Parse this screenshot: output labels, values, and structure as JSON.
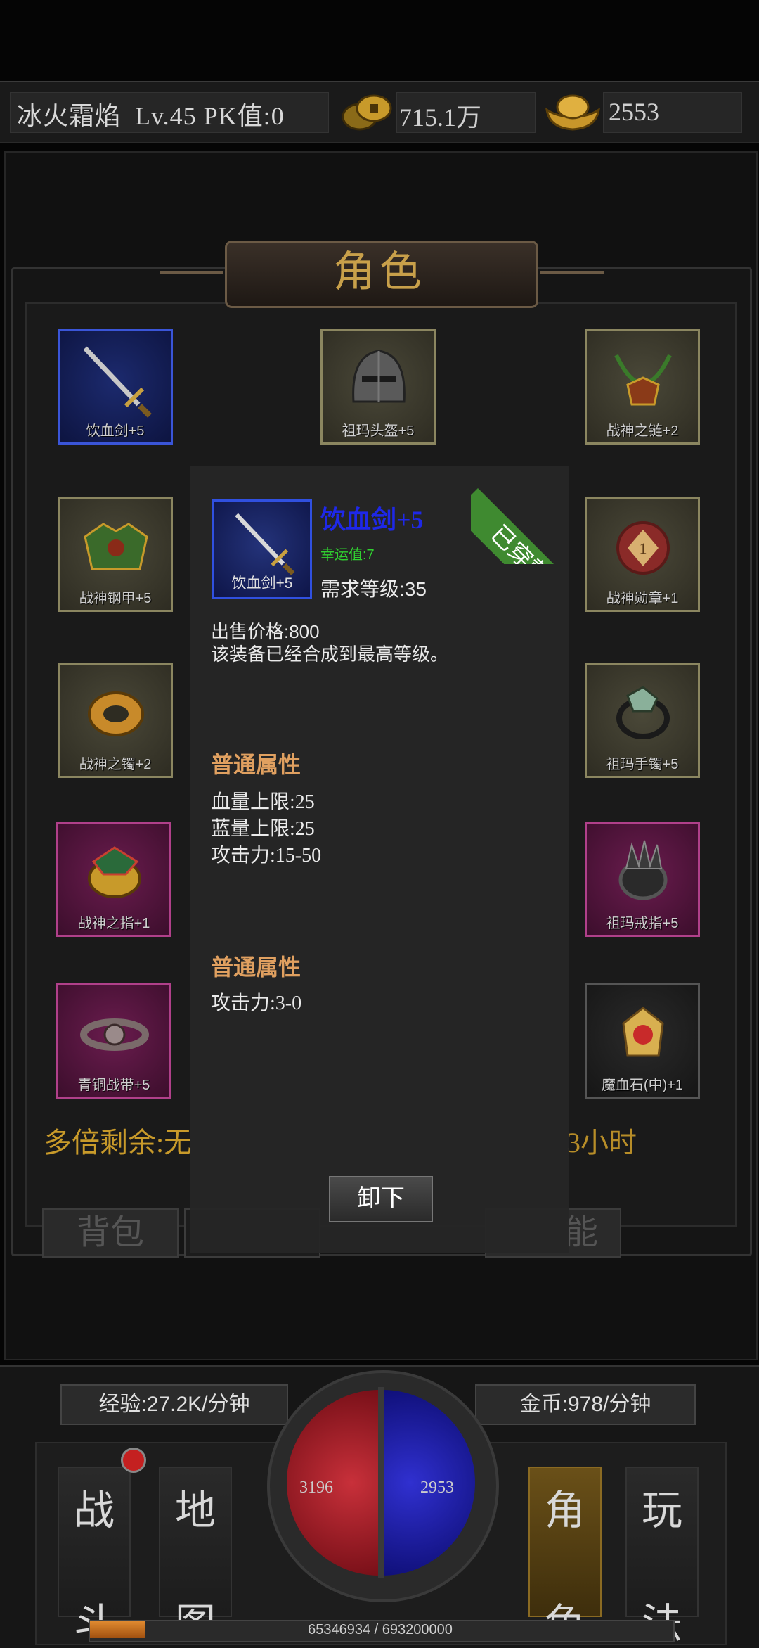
{
  "header": {
    "player_name": "冰火霜焰",
    "level": "Lv.45",
    "pk": "PK值:0",
    "gold": "715.1万",
    "ingots": "2553"
  },
  "panel": {
    "title": "角色",
    "multi_remaining": "多倍剩余:无",
    "time_remaining": "3小时"
  },
  "equipment": {
    "weapon": "饮血剑+5",
    "helmet": "祖玛头盔+5",
    "necklace": "战神之链+2",
    "armor": "战神钢甲+5",
    "medal": "战神勋章+1",
    "bracelet_left": "战神之镯+2",
    "bracelet_right": "祖玛手镯+5",
    "ring_left": "战神之指+1",
    "ring_right": "祖玛戒指+5",
    "belt": "青铜战带+5",
    "gem": "魔血石(中)+1"
  },
  "tabs": [
    "背包",
    "能"
  ],
  "popup": {
    "item_name": "饮血剑+5",
    "slot_label": "饮血剑+5",
    "luck": "幸运值:7",
    "required_level": "需求等级:35",
    "sell_price": "出售价格:800",
    "note": "该装备已经合成到最高等级。",
    "badge": "已穿戴",
    "section1_title": "普通属性",
    "section1_stats": [
      "血量上限:25",
      "蓝量上限:25",
      "攻击力:15-50"
    ],
    "section2_title": "普通属性",
    "section2_stats": [
      "攻击力:3-0"
    ],
    "unequip_label": "卸下"
  },
  "hud": {
    "exp_rate": "经验:27.2K/分钟",
    "gold_rate": "金币:978/分钟",
    "hp": "3196",
    "mp": "2953",
    "exp_text": "65346934 / 693200000",
    "exp_fraction": 0.094,
    "nav": {
      "battle_top": "战",
      "battle_bottom": "斗",
      "map_top": "地",
      "map_bottom": "图",
      "role_top": "角",
      "role_bottom": "色",
      "play_top": "玩",
      "play_bottom": "法"
    }
  }
}
